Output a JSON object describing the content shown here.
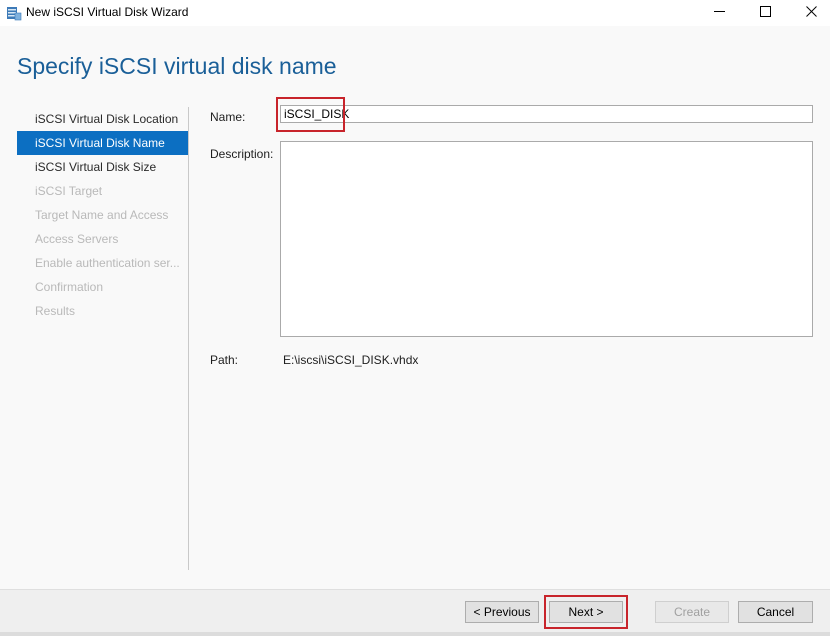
{
  "window": {
    "title": "New iSCSI Virtual Disk Wizard",
    "icons": {
      "app": "server-manager-icon",
      "minimize": "minimize-icon",
      "maximize": "maximize-icon",
      "close": "close-icon"
    }
  },
  "page": {
    "title": "Specify iSCSI virtual disk name"
  },
  "nav": {
    "items": [
      {
        "label": "iSCSI Virtual Disk Location",
        "state": "normal"
      },
      {
        "label": "iSCSI Virtual Disk Name",
        "state": "active"
      },
      {
        "label": "iSCSI Virtual Disk Size",
        "state": "normal"
      },
      {
        "label": "iSCSI Target",
        "state": "disabled"
      },
      {
        "label": "Target Name and Access",
        "state": "disabled"
      },
      {
        "label": "Access Servers",
        "state": "disabled"
      },
      {
        "label": "Enable authentication ser...",
        "state": "disabled"
      },
      {
        "label": "Confirmation",
        "state": "disabled"
      },
      {
        "label": "Results",
        "state": "disabled"
      }
    ]
  },
  "form": {
    "name_label": "Name:",
    "name_value": "iSCSI_DISK",
    "description_label": "Description:",
    "description_value": "",
    "path_label": "Path:",
    "path_value": "E:\\iscsi\\iSCSI_DISK.vhdx"
  },
  "footer": {
    "previous_label": "< Previous",
    "next_label": "Next >",
    "create_label": "Create",
    "cancel_label": "Cancel"
  },
  "colors": {
    "accent": "#0c6fc2",
    "title": "#1a5f98",
    "highlight": "#c8242b"
  }
}
